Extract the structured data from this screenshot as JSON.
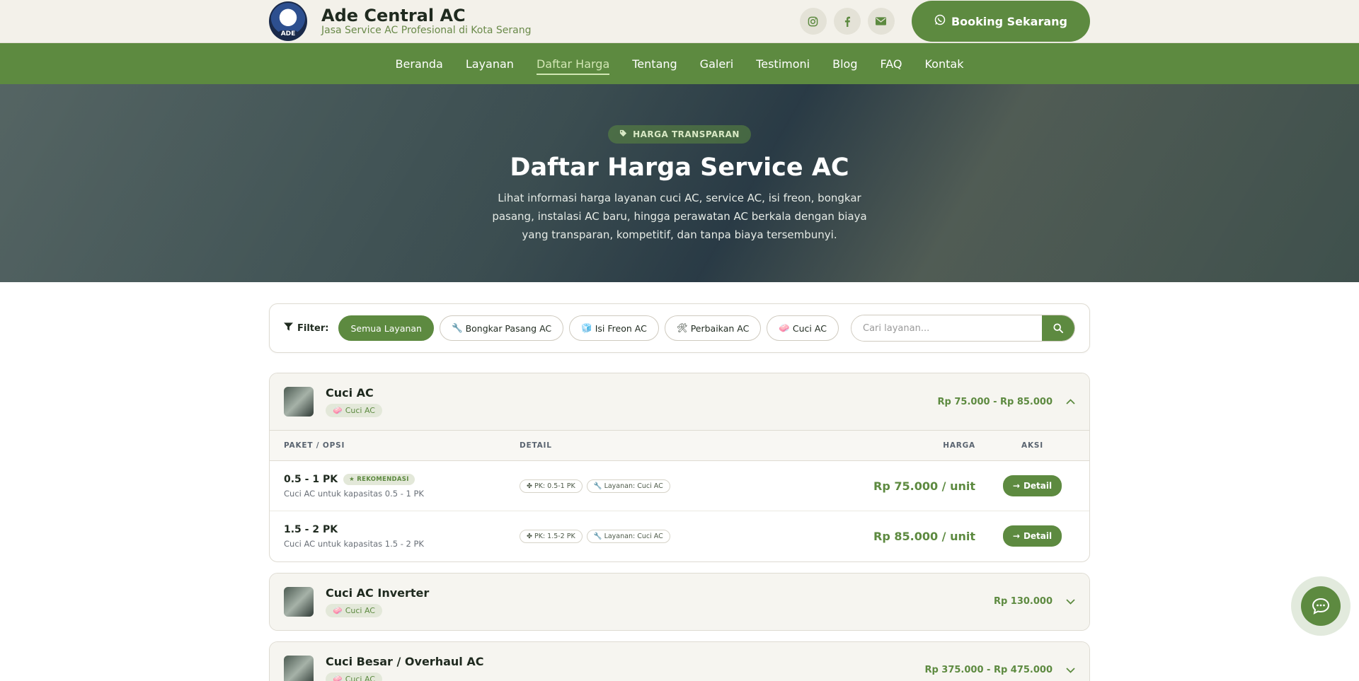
{
  "brand": {
    "name": "Ade Central AC",
    "tagline": "Jasa Service AC Profesional di Kota Serang",
    "logo_text": "ADE"
  },
  "header": {
    "booking_label": "Booking Sekarang",
    "socials": [
      "instagram-icon",
      "facebook-icon",
      "email-icon"
    ]
  },
  "nav": {
    "items": [
      "Beranda",
      "Layanan",
      "Daftar Harga",
      "Tentang",
      "Galeri",
      "Testimoni",
      "Blog",
      "FAQ",
      "Kontak"
    ],
    "active": "Daftar Harga"
  },
  "hero": {
    "badge": "HARGA TRANSPARAN",
    "title": "Daftar Harga Service AC",
    "description": "Lihat informasi harga layanan cuci AC, service AC, isi freon, bongkar pasang, instalasi AC baru, hingga perawatan AC berkala dengan biaya yang transparan, kompetitif, dan tanpa biaya tersembunyi."
  },
  "filter": {
    "label": "Filter:",
    "chips": [
      "Semua Layanan",
      "Bongkar Pasang AC",
      "Isi Freon AC",
      "Perbaikan AC",
      "Cuci AC"
    ],
    "active": "Semua Layanan",
    "search_placeholder": "Cari layanan..."
  },
  "table_headers": {
    "paket": "PAKET / OPSI",
    "detail": "DETAIL",
    "harga": "HARGA",
    "aksi": "AKSI"
  },
  "services": [
    {
      "title": "Cuci AC",
      "category": "Cuci AC",
      "price_range": "Rp 75.000 - Rp 85.000",
      "expanded": true,
      "options": [
        {
          "name": "0.5 - 1 PK",
          "badge": "REKOMENDASI",
          "description": "Cuci AC untuk kapasitas 0.5 - 1 PK",
          "tags": [
            "PK: 0.5-1 PK",
            "Layanan: Cuci AC"
          ],
          "price": "Rp 75.000 / unit",
          "action": "Detail"
        },
        {
          "name": "1.5 - 2 PK",
          "badge": "",
          "description": "Cuci AC untuk kapasitas 1.5 - 2 PK",
          "tags": [
            "PK: 1.5-2 PK",
            "Layanan: Cuci AC"
          ],
          "price": "Rp 85.000 / unit",
          "action": "Detail"
        }
      ]
    },
    {
      "title": "Cuci AC Inverter",
      "category": "Cuci AC",
      "price_range": "Rp 130.000",
      "expanded": false
    },
    {
      "title": "Cuci Besar / Overhaul AC",
      "category": "Cuci AC",
      "price_range": "Rp 375.000 - Rp 475.000",
      "expanded": false
    }
  ],
  "colors": {
    "primary": "#5d8a40",
    "header_bg": "#f3f1ea",
    "hero_overlay": "#283a37"
  }
}
